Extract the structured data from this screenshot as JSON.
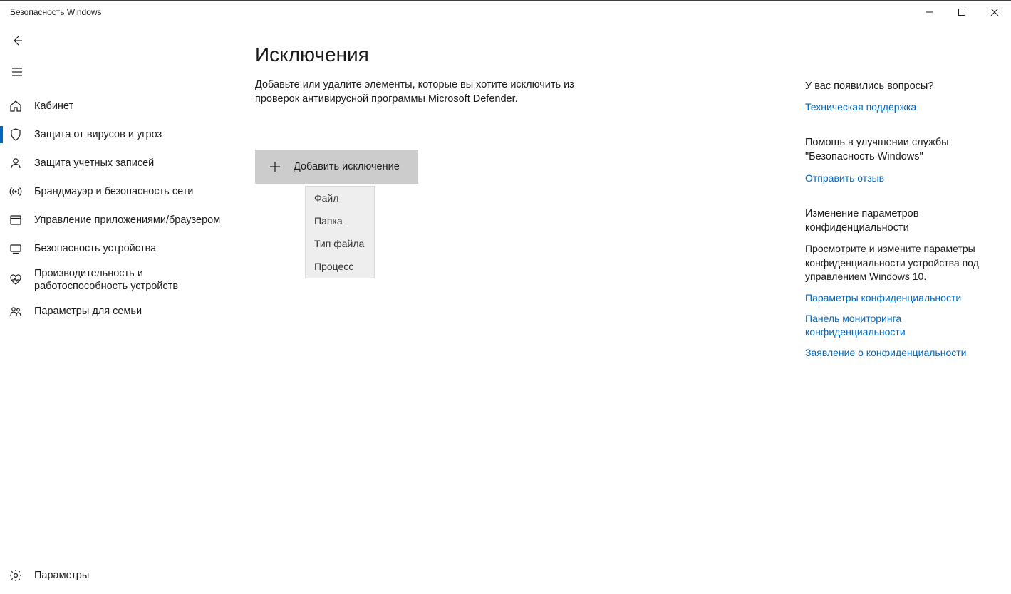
{
  "window": {
    "title": "Безопасность Windows"
  },
  "sidebar": {
    "items": [
      {
        "label": "Кабинет",
        "icon": "home"
      },
      {
        "label": "Защита от вирусов и угроз",
        "icon": "shield",
        "selected": true
      },
      {
        "label": "Защита учетных записей",
        "icon": "person"
      },
      {
        "label": "Брандмауэр и безопасность сети",
        "icon": "signal"
      },
      {
        "label": "Управление приложениями/браузером",
        "icon": "app"
      },
      {
        "label": "Безопасность устройства",
        "icon": "device"
      },
      {
        "label": "Производительность и работоспособность устройств",
        "icon": "heart",
        "tall": true
      },
      {
        "label": "Параметры для семьи",
        "icon": "family"
      }
    ],
    "settings_label": "Параметры"
  },
  "content": {
    "title": "Исключения",
    "description": "Добавьте или удалите элементы, которые вы хотите исключить из проверок антивирусной программы Microsoft Defender.",
    "add_button": "Добавить исключение",
    "dropdown": [
      "Файл",
      "Папка",
      "Тип файла",
      "Процесс"
    ]
  },
  "right": {
    "sections": [
      {
        "heading": "У вас появились вопросы?",
        "links": [
          "Техническая поддержка"
        ]
      },
      {
        "heading": "Помощь в улучшении службы \"Безопасность Windows\"",
        "links": [
          "Отправить отзыв"
        ]
      },
      {
        "heading": "Изменение параметров конфиденциальности",
        "description": "Просмотрите и измените параметры конфиденциальности устройства под управлением Windows 10.",
        "links": [
          "Параметры конфиденциальности",
          "Панель мониторинга конфиденциальности",
          "Заявление о конфиденциальности"
        ]
      }
    ]
  }
}
